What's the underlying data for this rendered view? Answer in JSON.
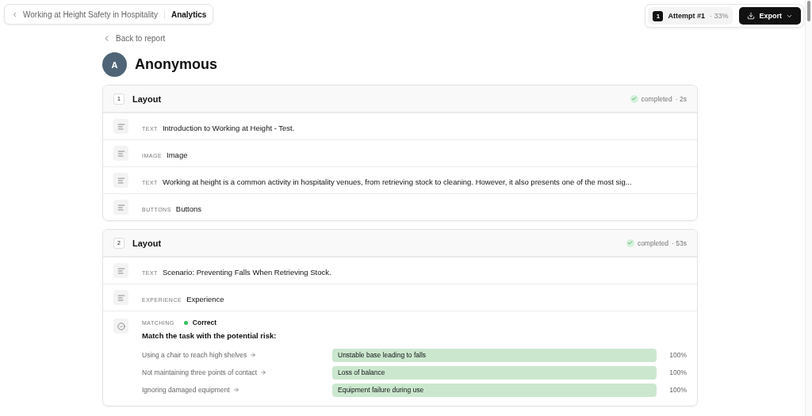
{
  "breadcrumb": {
    "parent": "Working at Height Safety in Hospitality",
    "current": "Analytics"
  },
  "attempt": {
    "number": "1",
    "label": "Attempt #1",
    "score": "· 33%"
  },
  "export_button": "Export",
  "back_link": "Back to report",
  "user": {
    "initial": "A",
    "name": "Anonymous"
  },
  "sections": [
    {
      "number": "1",
      "title": "Layout",
      "status": "completed",
      "duration": "· 2s",
      "completed": true,
      "items": [
        {
          "kind": "plain",
          "type": "TEXT",
          "text": "Introduction to Working at Height - Test."
        },
        {
          "kind": "plain",
          "type": "IMAGE",
          "text": "Image"
        },
        {
          "kind": "plain",
          "type": "TEXT",
          "text": "Working at height is a common activity in hospitality venues, from retrieving stock to cleaning. However, it also presents one of the most sig..."
        },
        {
          "kind": "plain",
          "type": "BUTTONS",
          "text": "Buttons"
        }
      ]
    },
    {
      "number": "2",
      "title": "Layout",
      "status": "completed",
      "duration": "· 53s",
      "completed": true,
      "items": [
        {
          "kind": "plain",
          "type": "TEXT",
          "text": "Scenario: Preventing Falls When Retrieving Stock."
        },
        {
          "kind": "plain",
          "type": "EXPERIENCE",
          "text": "Experience"
        },
        {
          "kind": "matching",
          "type": "MATCHING",
          "result": "Correct",
          "correct": true,
          "text": "Match the task with the potential risk:",
          "pairs": [
            {
              "task": "Using a chair to reach high shelves",
              "risk": "Unstable base leading to falls",
              "level": 1,
              "percent": "100%"
            },
            {
              "task": "Not maintaining three points of contact",
              "risk": "Loss of balance",
              "level": 1,
              "percent": "100%"
            },
            {
              "task": "Ignoring damaged equipment",
              "risk": "Equipment failure during use",
              "level": 1,
              "percent": "100%"
            }
          ]
        }
      ]
    }
  ]
}
